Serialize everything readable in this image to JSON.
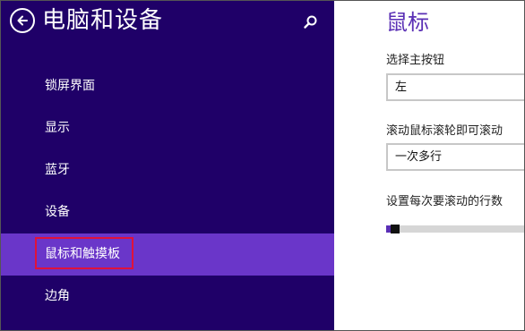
{
  "nav": {
    "title": "电脑和设备",
    "back_icon": "back-arrow-icon",
    "search_icon": "search-icon",
    "items": [
      {
        "label": "锁屏界面"
      },
      {
        "label": "显示"
      },
      {
        "label": "蓝牙"
      },
      {
        "label": "设备"
      },
      {
        "label": "鼠标和触摸板",
        "selected": true
      },
      {
        "label": "边角"
      }
    ]
  },
  "detail": {
    "title": "鼠标",
    "primary_button_label": "选择主按钮",
    "primary_button_value": "左",
    "scroll_label": "滚动鼠标滚轮即可滚动",
    "scroll_value": "一次多行",
    "lines_label": "设置每次要滚动的行数",
    "lines_slider_fraction": 0.03
  },
  "colors": {
    "nav_background": "#1f0068",
    "selected_item": "#6a36c9",
    "accent": "#5a2fb5",
    "highlight_border": "#e0123a"
  }
}
